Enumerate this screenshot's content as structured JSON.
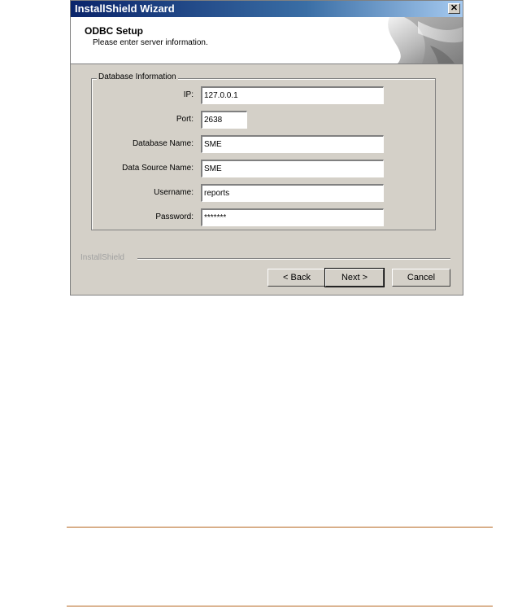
{
  "window": {
    "title": "InstallShield Wizard",
    "close_glyph": "✕"
  },
  "header": {
    "title": "ODBC Setup",
    "subtitle": "Please enter server information."
  },
  "group": {
    "legend": "Database Information"
  },
  "fields": {
    "ip": {
      "label": "IP:",
      "value": "127.0.0.1"
    },
    "port": {
      "label": "Port:",
      "value": "2638"
    },
    "database_name": {
      "label": "Database Name:",
      "value": "SME"
    },
    "data_source_name": {
      "label": "Data Source Name:",
      "value": "SME"
    },
    "username": {
      "label": "Username:",
      "value": "reports"
    },
    "password": {
      "label": "Password:",
      "value": "*******"
    }
  },
  "brand": "InstallShield",
  "buttons": {
    "back": "< Back",
    "next": "Next >",
    "cancel": "Cancel"
  },
  "colors": {
    "titlebar_start": "#0a246a",
    "dialog_face": "#d4d0c8",
    "doc_rule": "#b5651d"
  }
}
